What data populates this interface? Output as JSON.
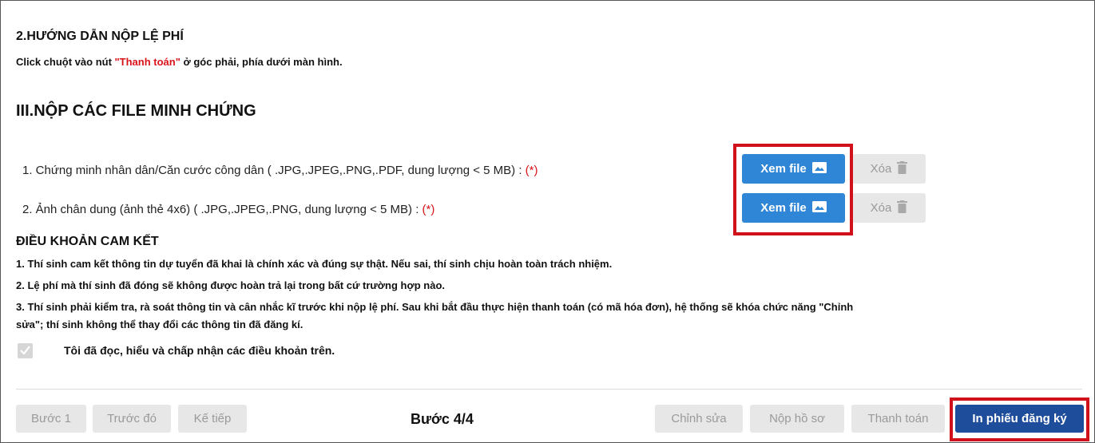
{
  "guide": {
    "title": "2.HƯỚNG DẪN NỘP LỆ PHÍ",
    "note_prefix": "Click chuột vào nút ",
    "note_button": "\"Thanh toán\"",
    "note_suffix": " ở góc phải, phía dưới màn hình."
  },
  "evidence": {
    "title": "III.NỘP CÁC FILE MINH CHỨNG",
    "files": [
      {
        "label": "1. Chứng minh nhân dân/Căn cước công dân ( .JPG,.JPEG,.PNG,.PDF, dung lượng < 5 MB) : ",
        "required": "(*)",
        "view_label": "Xem file",
        "delete_label": "Xóa"
      },
      {
        "label": "2. Ảnh chân dung (ảnh thẻ 4x6) ( .JPG,.JPEG,.PNG, dung lượng < 5 MB) : ",
        "required": "(*)",
        "view_label": "Xem file",
        "delete_label": "Xóa"
      }
    ]
  },
  "terms": {
    "title": "ĐIỀU KHOẢN CAM KẾT",
    "items": [
      "1. Thí sinh cam kết thông tin dự tuyển đã khai là chính xác và đúng sự thật. Nếu sai, thí sinh chịu hoàn toàn trách nhiệm.",
      "2. Lệ phí mà thí sinh đã đóng sẽ không được hoàn trả lại trong bất cứ trường hợp nào.",
      "3. Thí sinh phải kiểm tra, rà soát thông tin và cân nhắc kĩ trước khi nộp lệ phí. Sau khi bắt đầu thực hiện thanh toán (có mã hóa đơn), hệ thống sẽ khóa chức năng \"Chỉnh",
      "sửa\"; thí sinh không thể thay đổi các thông tin đã đăng kí."
    ],
    "agree_label": "Tôi đã đọc, hiểu và chấp nhận các điều khoản trên.",
    "agree_checked": true
  },
  "footer": {
    "step1": "Bước 1",
    "prev": "Trước đó",
    "next": "Kế tiếp",
    "step_indicator": "Bước 4/4",
    "edit": "Chỉnh sửa",
    "submit": "Nộp hồ sơ",
    "pay": "Thanh toán",
    "print": "In phiếu đăng ký"
  },
  "colors": {
    "primary_blue": "#2f86d6",
    "navy": "#1e4d9c",
    "highlight_red": "#d0101a",
    "required_red": "#d9131a"
  }
}
